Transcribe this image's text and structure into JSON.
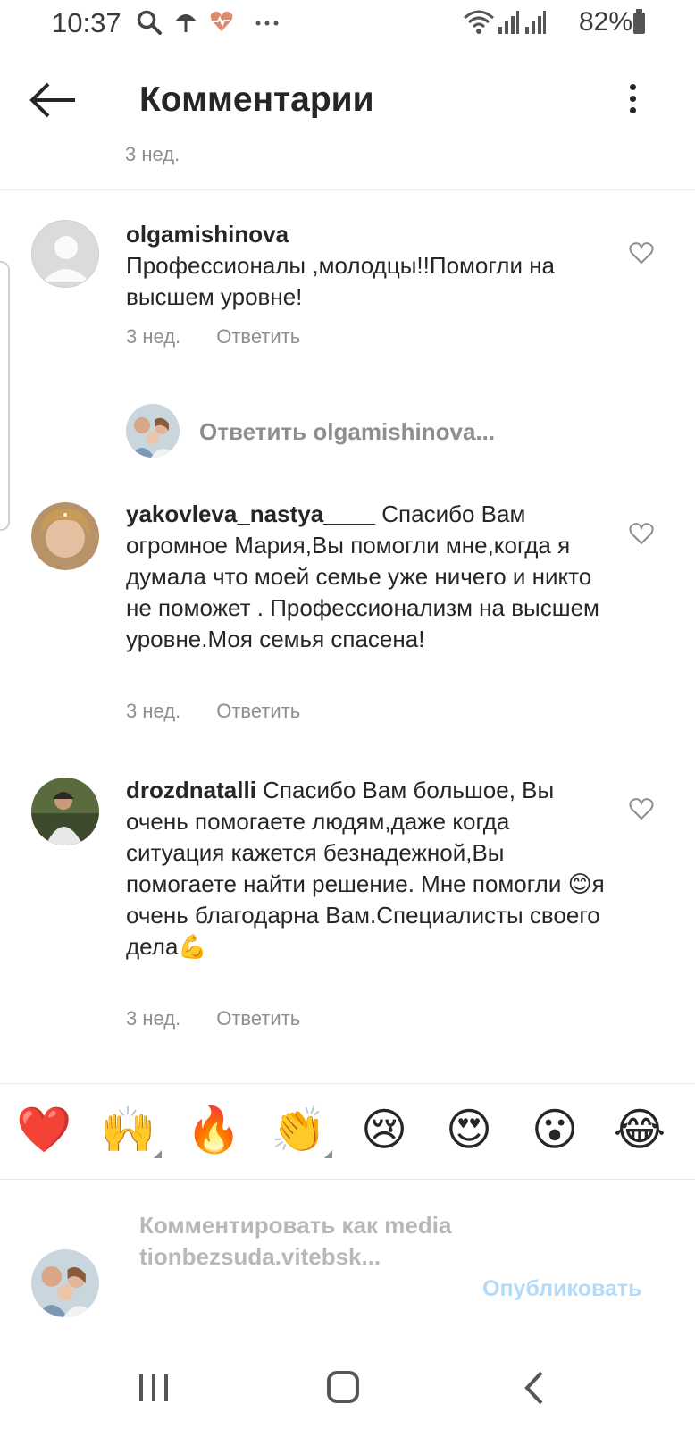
{
  "status_bar": {
    "time": "10:37",
    "battery": "82%",
    "icons": [
      "search-icon",
      "umbrella-icon",
      "heart-pulse-icon",
      "more-dots-icon",
      "wifi-icon",
      "signal-icon",
      "signal-icon",
      "battery-icon"
    ]
  },
  "header": {
    "title": "Комментарии",
    "back_icon": "arrow-left-icon",
    "menu_icon": "more-vertical-icon"
  },
  "previous_time": "3 нед.",
  "comments": [
    {
      "username": "olgamishinova",
      "text": "Профессионалы ,молодцы!!Помогли на высшем уровне!",
      "inline": false,
      "time": "3 нед.",
      "reply_label": "Ответить"
    },
    {
      "username": "yakovleva_nastya____",
      "text": "Спасибо Вам огромное Мария,Вы помогли мне,когда я думала что моей семье уже ничего и никто не поможет . Профессионализм на высшем уровне.Моя семья спасена!",
      "inline": true,
      "time": "3 нед.",
      "reply_label": "Ответить"
    },
    {
      "username": "drozdnatalli",
      "text": "Спасибо  Вам  большое, Вы очень  помогаете людям,даже когда  ситуация кажется безнадежной,Вы помогаете  найти решение. Мне помогли 😊я очень благодарна  Вам.Специалисты своего дела💪",
      "inline": true,
      "time": "3 нед.",
      "reply_label": "Ответить"
    }
  ],
  "reply_box": {
    "placeholder": "Ответить olgamishinova..."
  },
  "emoji_bar": [
    "❤️",
    "🙌",
    "🔥",
    "👏",
    "😢",
    "😍",
    "😮",
    "😂"
  ],
  "compose": {
    "placeholder": "Комментировать как mediationbezsuda.vitebsk...",
    "publish_label": "Опубликовать"
  },
  "colors": {
    "text": "#262626",
    "secondary": "#8e8e8e",
    "publish_disabled": "#b3dbf9"
  }
}
